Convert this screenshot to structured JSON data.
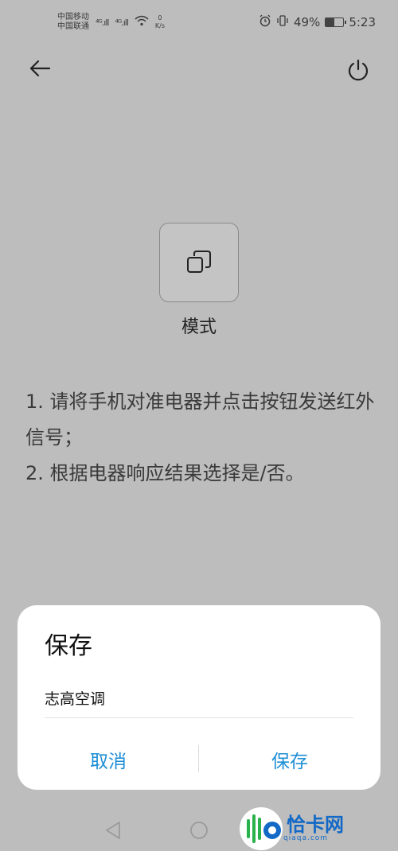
{
  "status_bar": {
    "carrier_1": "中国移动",
    "carrier_2": "中国联通",
    "signal_1": "⁴ᴳ.ıll",
    "signal_2": "⁴ᴳ.ıll",
    "net_speed_value": "0",
    "net_speed_unit": "K/s",
    "battery_percent": "49%",
    "battery_level": 0.49,
    "time": "5:23"
  },
  "header": {
    "back_icon": "arrow-left-icon",
    "power_icon": "power-icon"
  },
  "mode": {
    "icon": "copy-mode-icon",
    "label": "模式"
  },
  "instructions": {
    "line_1": "1. 请将手机对准电器并点击按钮发送红外信号；",
    "line_2": "2. 根据电器响应结果选择是/否。"
  },
  "dialog": {
    "title": "保存",
    "input_value": "志高空调",
    "cancel_label": "取消",
    "save_label": "保存"
  },
  "nav": {
    "back_icon": "triangle-back-icon",
    "home_icon": "circle-home-icon"
  },
  "watermark": {
    "text": "恰卡网",
    "sub": "qiaqa.com"
  },
  "colors": {
    "accent": "#1f8fd6",
    "overlay_bg": "#bdbdbd",
    "dialog_bg": "#ffffff"
  }
}
